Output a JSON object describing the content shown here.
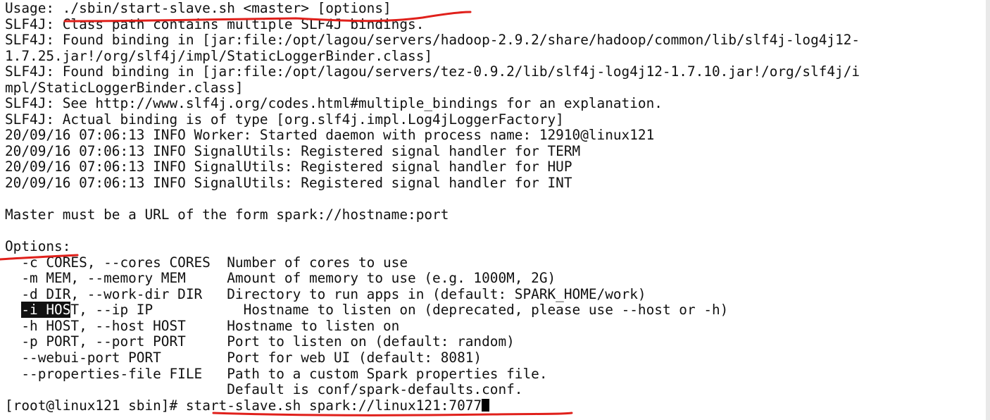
{
  "terminal": {
    "background": "#ffffff",
    "text_color": "#111111",
    "annotation_color": "#e0201b",
    "lines": [
      "Usage: ./sbin/start-slave.sh <master> [options]",
      "SLF4J: Class path contains multiple SLF4J bindings.",
      "SLF4J: Found binding in [jar:file:/opt/lagou/servers/hadoop-2.9.2/share/hadoop/common/lib/slf4j-log4j12-",
      "1.7.25.jar!/org/slf4j/impl/StaticLoggerBinder.class]",
      "SLF4J: Found binding in [jar:file:/opt/lagou/servers/tez-0.9.2/lib/slf4j-log4j12-1.7.10.jar!/org/slf4j/i",
      "mpl/StaticLoggerBinder.class]",
      "SLF4J: See http://www.slf4j.org/codes.html#multiple_bindings for an explanation.",
      "SLF4J: Actual binding is of type [org.slf4j.impl.Log4jLoggerFactory]",
      "20/09/16 07:06:13 INFO Worker: Started daemon with process name: 12910@linux121",
      "20/09/16 07:06:13 INFO SignalUtils: Registered signal handler for TERM",
      "20/09/16 07:06:13 INFO SignalUtils: Registered signal handler for HUP",
      "20/09/16 07:06:13 INFO SignalUtils: Registered signal handler for INT",
      "",
      "Master must be a URL of the form spark://hostname:port",
      "",
      "Options:",
      "  -c CORES, --cores CORES  Number of cores to use",
      "  -m MEM, --memory MEM     Amount of memory to use (e.g. 1000M, 2G)",
      "  -d DIR, --work-dir DIR   Directory to run apps in (default: SPARK_HOME/work)",
      "",
      "  -h HOST, --host HOST     Hostname to listen on",
      "  -p PORT, --port PORT     Port to listen on (default: random)",
      "  --webui-port PORT        Port for web UI (default: 8081)",
      "  --properties-file FILE   Path to a custom Spark properties file.",
      "                           Default is conf/spark-defaults.conf."
    ],
    "ip_option_line": {
      "indent": "  ",
      "selected": "-i HOS",
      "rest": "T, --ip IP           Hostname to listen on (deprecated, please use --host or -h)"
    },
    "prompt": {
      "text": "[root@linux121 sbin]# ",
      "command": "start-slave.sh spark://linux121:7077"
    }
  }
}
